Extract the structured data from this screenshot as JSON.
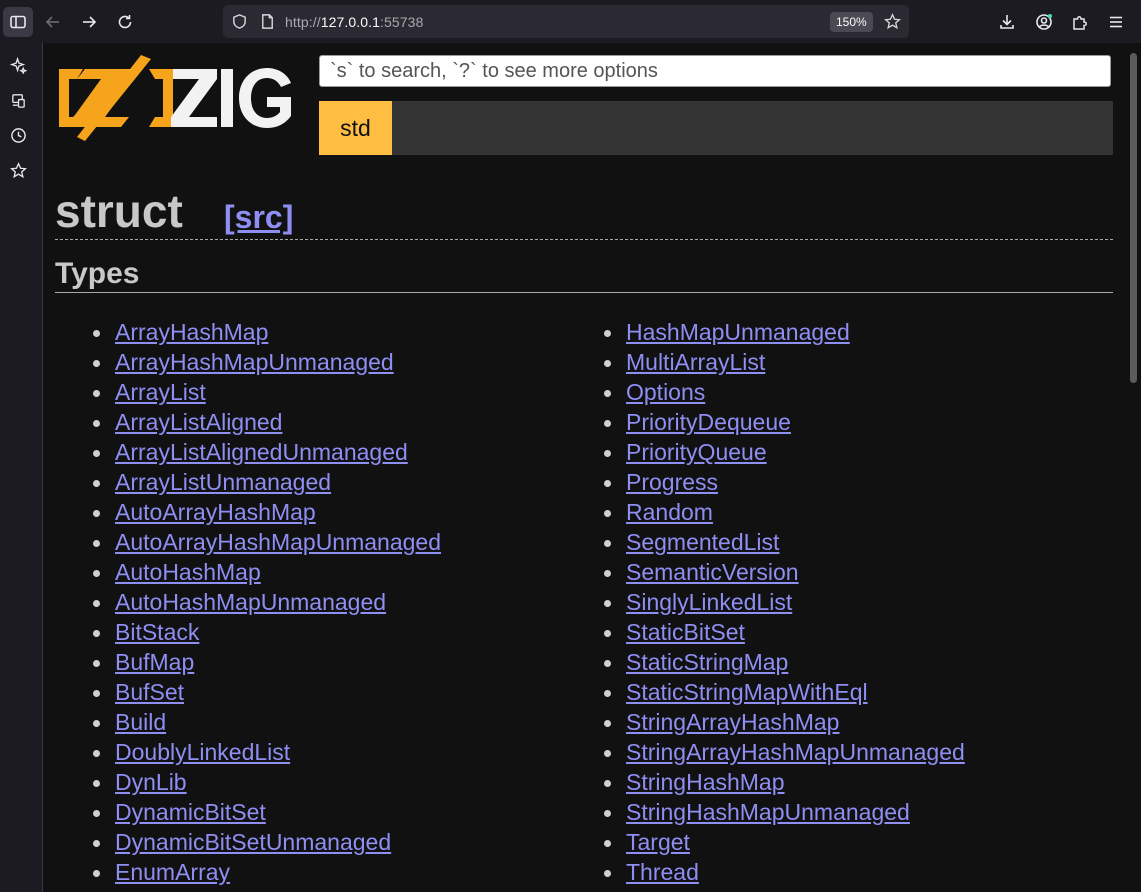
{
  "browser": {
    "url_scheme": "http://",
    "url_host": "127.0.0.1",
    "url_port": ":55738",
    "zoom": "150%"
  },
  "page": {
    "search_placeholder": "`s` to search, `?` to see more options",
    "nav_item": "std",
    "title": "struct",
    "src_link": "[src]",
    "types_heading": "Types"
  },
  "types_left": [
    "ArrayHashMap",
    "ArrayHashMapUnmanaged",
    "ArrayList",
    "ArrayListAligned",
    "ArrayListAlignedUnmanaged",
    "ArrayListUnmanaged",
    "AutoArrayHashMap",
    "AutoArrayHashMapUnmanaged",
    "AutoHashMap",
    "AutoHashMapUnmanaged",
    "BitStack",
    "BufMap",
    "BufSet",
    "Build",
    "DoublyLinkedList",
    "DynLib",
    "DynamicBitSet",
    "DynamicBitSetUnmanaged",
    "EnumArray"
  ],
  "types_right": [
    "HashMapUnmanaged",
    "MultiArrayList",
    "Options",
    "PriorityDequeue",
    "PriorityQueue",
    "Progress",
    "Random",
    "SegmentedList",
    "SemanticVersion",
    "SinglyLinkedList",
    "StaticBitSet",
    "StaticStringMap",
    "StaticStringMapWithEql",
    "StringArrayHashMap",
    "StringArrayHashMapUnmanaged",
    "StringHashMap",
    "StringHashMapUnmanaged",
    "Target",
    "Thread"
  ],
  "colors": {
    "page_bg": "#111111",
    "accent": "#ffbd42",
    "link": "#8e8ef3",
    "logo_orange": "#f7a41d"
  }
}
